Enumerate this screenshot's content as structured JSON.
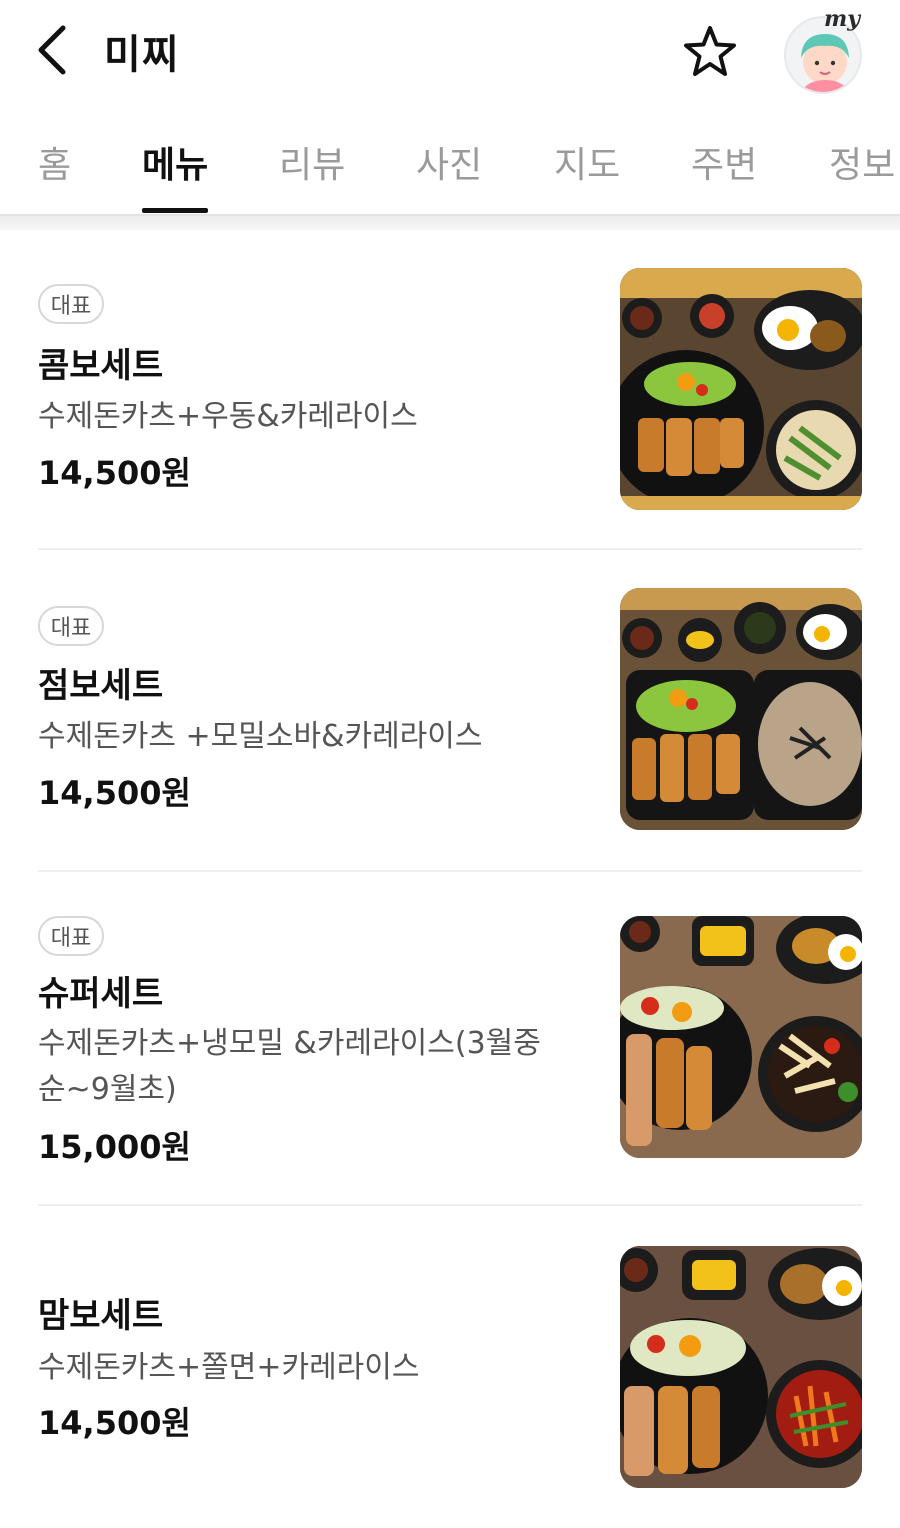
{
  "header": {
    "title": "미찌",
    "my_label": "my"
  },
  "tabs": [
    {
      "label": "홈"
    },
    {
      "label": "메뉴",
      "active": true
    },
    {
      "label": "리뷰"
    },
    {
      "label": "사진"
    },
    {
      "label": "지도"
    },
    {
      "label": "주변"
    },
    {
      "label": "정보"
    }
  ],
  "menu": [
    {
      "badge": "대표",
      "name": "콤보세트",
      "desc": "수제돈카츠+우동&카레라이스",
      "price": "14,500원"
    },
    {
      "badge": "대표",
      "name": "점보세트",
      "desc": "수제돈카츠 +모밀소바&카레라이스",
      "price": "14,500원"
    },
    {
      "badge": "대표",
      "name": "슈퍼세트",
      "desc": "수제돈카츠+냉모밀 &카레라이스(3월중순~9월초)",
      "desc_line1": "수제돈카츠+냉모밀 &카레라이스(3월중",
      "desc_line2": "순~9월초)",
      "price": "15,000원"
    },
    {
      "name": "맘보세트",
      "desc": "수제돈카츠+쫄면+카레라이스",
      "price": "14,500원"
    }
  ],
  "colors": {
    "text_primary": "#111111",
    "text_secondary": "#555555",
    "tab_inactive": "#9a9a9a",
    "divider": "#eeeeee",
    "badge_border": "#d7d7d7"
  },
  "icons": [
    "chevron-left-icon",
    "star-outline-icon",
    "avatar-icon"
  ]
}
